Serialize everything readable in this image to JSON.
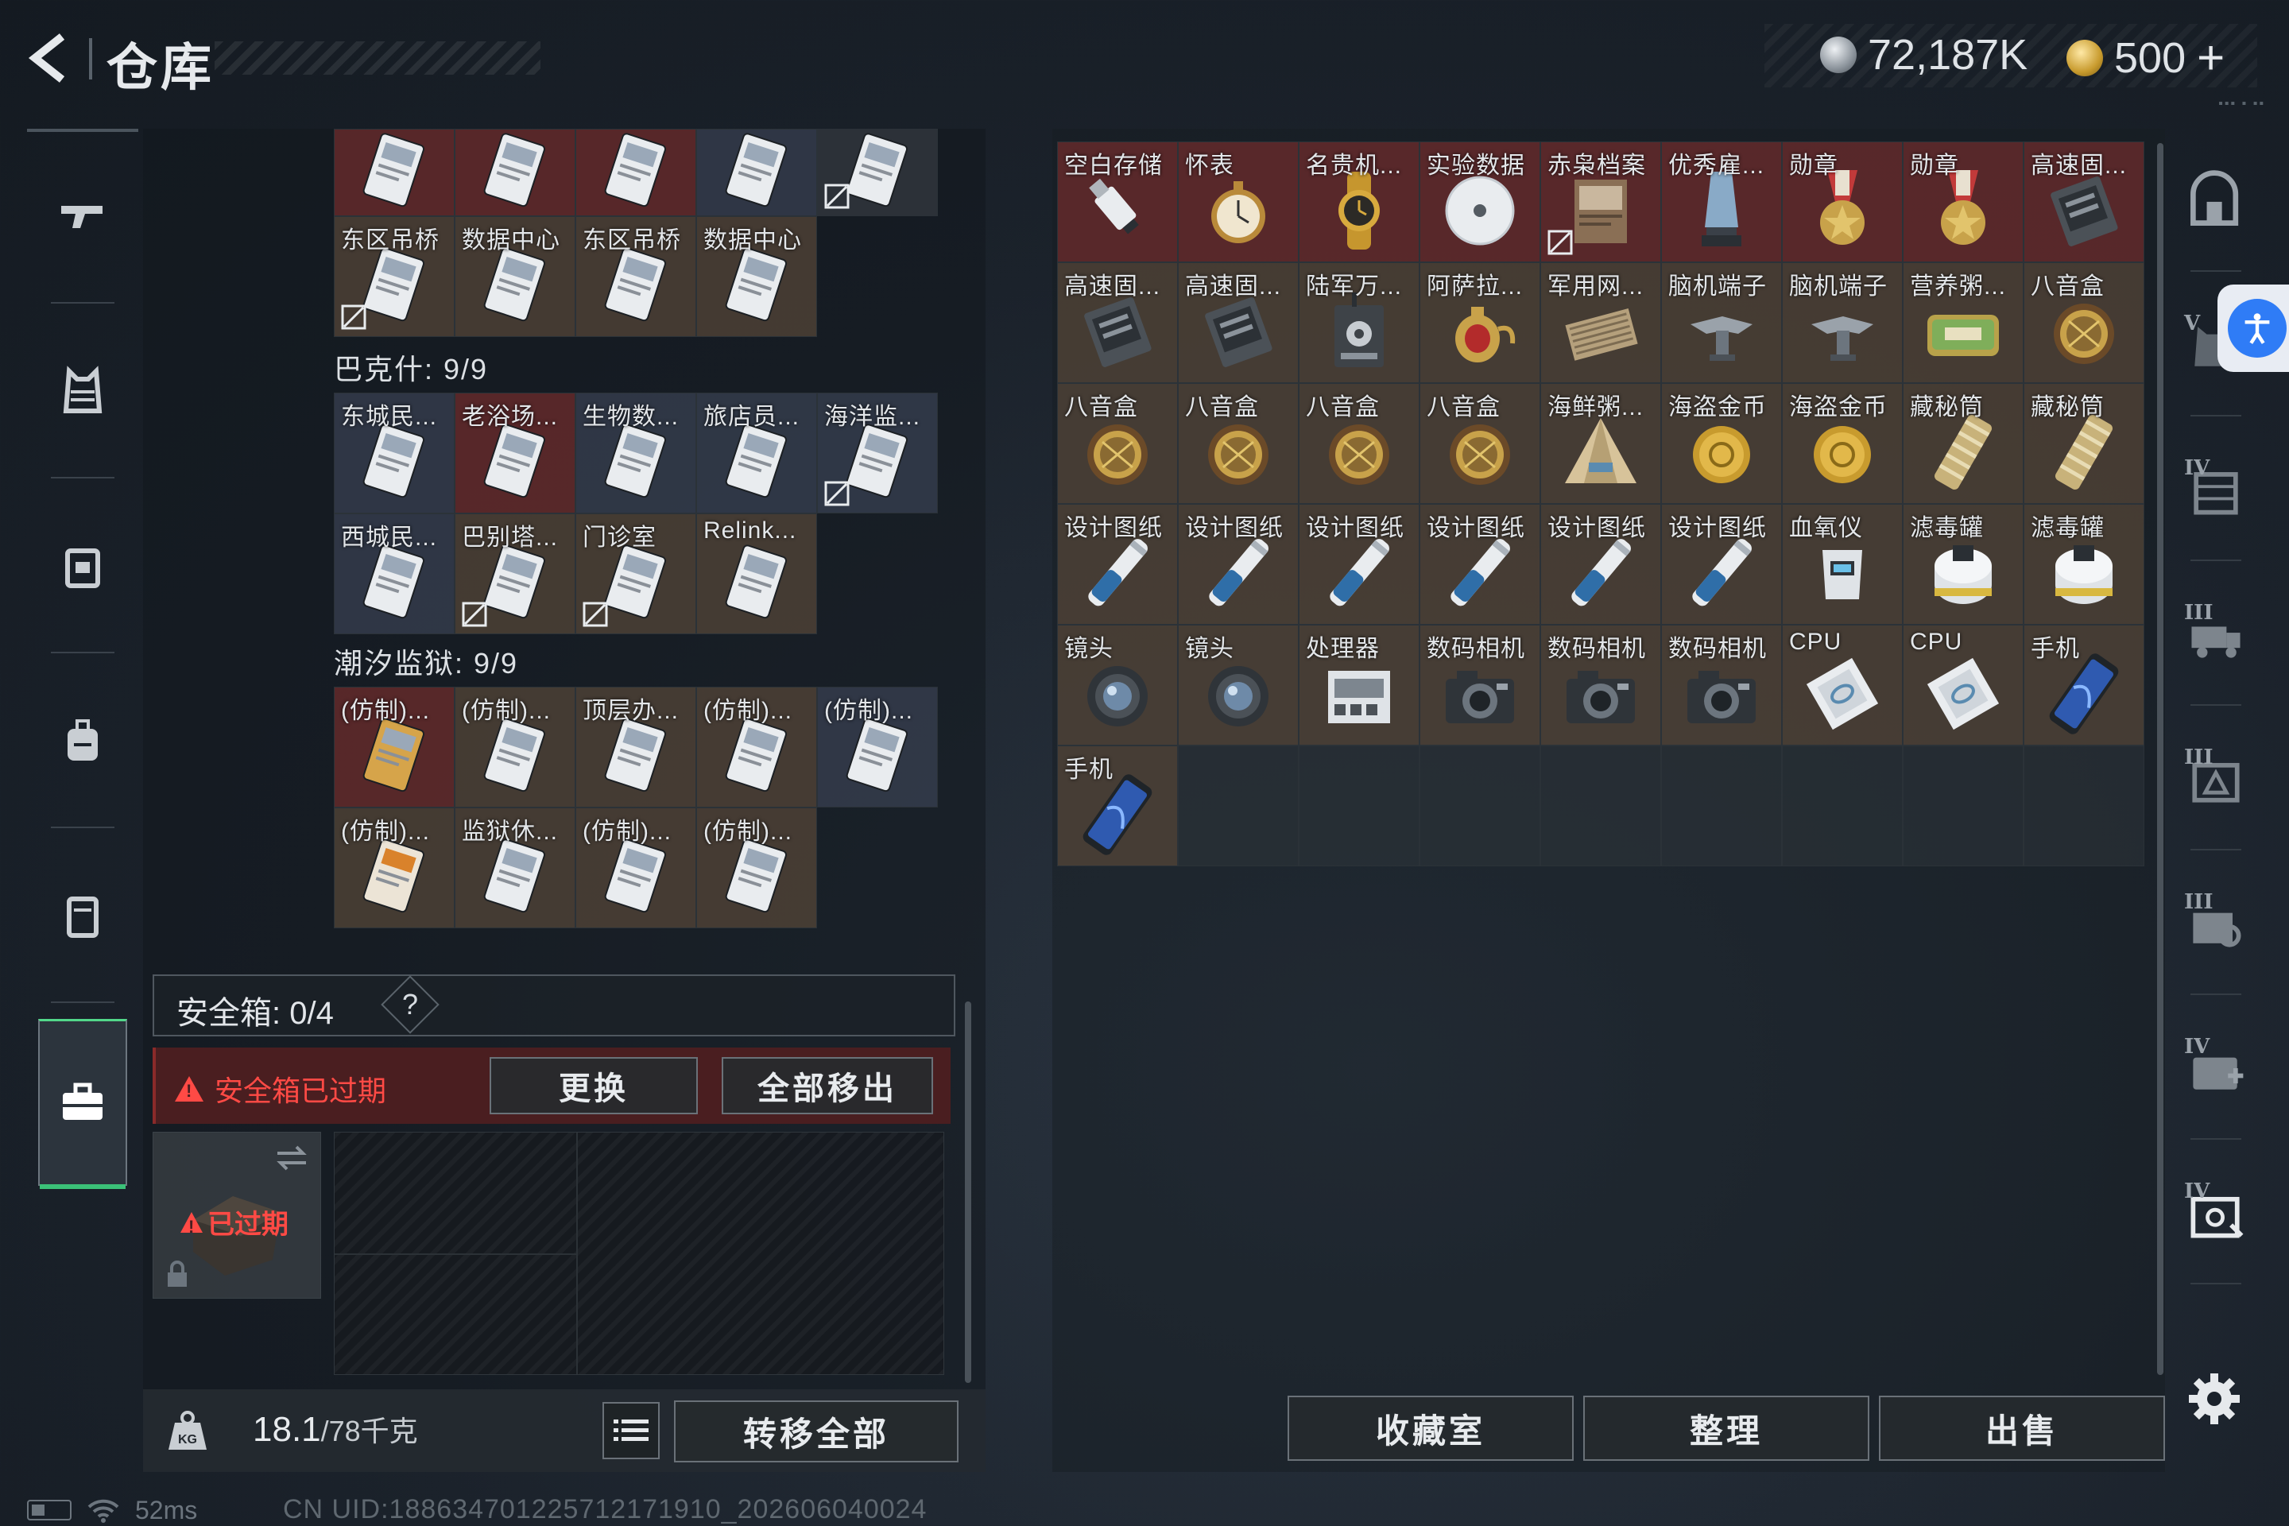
{
  "header": {
    "title": "仓库",
    "currency_silver": "72,187K",
    "currency_gold": "500",
    "plus_label": "+"
  },
  "left_nav": [
    {
      "name": "weapon-tab",
      "icon": "gun-icon"
    },
    {
      "name": "armor-tab",
      "icon": "vest-icon"
    },
    {
      "name": "chest-rig-tab",
      "icon": "rig-icon"
    },
    {
      "name": "backpack-tab",
      "icon": "backpack-icon"
    },
    {
      "name": "pouch-tab",
      "icon": "pouch-icon"
    },
    {
      "name": "safe-box-tab",
      "icon": "briefcase-icon",
      "active": true
    }
  ],
  "backpack": {
    "top_rows": [
      [
        {
          "label": "",
          "bg": "red"
        },
        {
          "label": "",
          "bg": "red"
        },
        {
          "label": "",
          "bg": "red"
        },
        {
          "label": "",
          "bg": "blue"
        },
        {
          "label": "",
          "bg": "dark",
          "mark": true
        }
      ],
      [
        {
          "label": "东区吊桥",
          "bg": "brown",
          "mark": true
        },
        {
          "label": "数据中心",
          "bg": "brown"
        },
        {
          "label": "东区吊桥",
          "bg": "brown"
        },
        {
          "label": "数据中心",
          "bg": "brown"
        }
      ]
    ],
    "group1_label": "巴克什: 9/9",
    "group1": [
      [
        {
          "label": "东城民...",
          "bg": "blue"
        },
        {
          "label": "老浴场...",
          "bg": "red"
        },
        {
          "label": "生物数...",
          "bg": "blue"
        },
        {
          "label": "旅店员...",
          "bg": "blue"
        },
        {
          "label": "海洋监...",
          "bg": "blue",
          "mark": true
        }
      ],
      [
        {
          "label": "西城民...",
          "bg": "blue"
        },
        {
          "label": "巴别塔...",
          "bg": "brown",
          "mark": true
        },
        {
          "label": "门诊室",
          "bg": "brown",
          "mark": true
        },
        {
          "label": "Relink...",
          "bg": "brown"
        }
      ]
    ],
    "group2_label": "潮汐监狱: 9/9",
    "group2": [
      [
        {
          "label": "(仿制)...",
          "bg": "red",
          "gold": true
        },
        {
          "label": "(仿制)...",
          "bg": "brown"
        },
        {
          "label": "顶层办...",
          "bg": "brown"
        },
        {
          "label": "(仿制)...",
          "bg": "brown"
        },
        {
          "label": "(仿制)...",
          "bg": "blue"
        }
      ],
      [
        {
          "label": "(仿制)...",
          "bg": "brown",
          "orange": true
        },
        {
          "label": "监狱休...",
          "bg": "brown"
        },
        {
          "label": "(仿制)...",
          "bg": "brown"
        },
        {
          "label": "(仿制)...",
          "bg": "brown"
        }
      ]
    ]
  },
  "safe_box": {
    "header": "安全箱: 0/4",
    "help": "?",
    "expired_warning": "安全箱已过期",
    "replace_label": "更换",
    "remove_all_label": "全部移出",
    "item_expired_label": "已过期"
  },
  "bottom_left": {
    "weight_value": "18.1",
    "weight_unit": "/78千克",
    "transfer_all_label": "转移全部"
  },
  "stash": {
    "items": [
      {
        "label": "空白存储",
        "icon": "usb",
        "bg": "red"
      },
      {
        "label": "怀表",
        "icon": "watch",
        "bg": "red"
      },
      {
        "label": "名贵机...",
        "icon": "wristwatch",
        "bg": "red"
      },
      {
        "label": "实验数据",
        "icon": "disc",
        "bg": "red"
      },
      {
        "label": "赤枭档案",
        "icon": "file",
        "bg": "red",
        "mark": true
      },
      {
        "label": "优秀雇...",
        "icon": "trophy",
        "bg": "red"
      },
      {
        "label": "勋章",
        "icon": "medal",
        "bg": "red"
      },
      {
        "label": "勋章",
        "icon": "medal",
        "bg": "red"
      },
      {
        "label": "高速固...",
        "icon": "ssd",
        "bg": "red"
      },
      {
        "label": "高速固...",
        "icon": "ssd",
        "bg": "brown"
      },
      {
        "label": "高速固...",
        "icon": "ssd",
        "bg": "brown"
      },
      {
        "label": "陆军万...",
        "icon": "radio",
        "bg": "brown"
      },
      {
        "label": "阿萨拉...",
        "icon": "teapot",
        "bg": "brown"
      },
      {
        "label": "军用网...",
        "icon": "router",
        "bg": "brown"
      },
      {
        "label": "脑机端子",
        "icon": "drone",
        "bg": "brown"
      },
      {
        "label": "脑机端子",
        "icon": "drone",
        "bg": "brown"
      },
      {
        "label": "营养粥...",
        "icon": "tin",
        "bg": "brown"
      },
      {
        "label": "八音盒",
        "icon": "musicbox",
        "bg": "brown"
      },
      {
        "label": "八音盒",
        "icon": "musicbox",
        "bg": "brown"
      },
      {
        "label": "八音盒",
        "icon": "musicbox",
        "bg": "brown"
      },
      {
        "label": "八音盒",
        "icon": "musicbox",
        "bg": "brown"
      },
      {
        "label": "八音盒",
        "icon": "musicbox",
        "bg": "brown"
      },
      {
        "label": "海鲜粥...",
        "icon": "pyramid",
        "bg": "brown"
      },
      {
        "label": "海盗金币",
        "icon": "coin",
        "bg": "brown"
      },
      {
        "label": "海盗金币",
        "icon": "coin",
        "bg": "brown"
      },
      {
        "label": "藏秘筒",
        "icon": "scroll",
        "bg": "brown"
      },
      {
        "label": "藏秘筒",
        "icon": "scroll",
        "bg": "brown"
      },
      {
        "label": "设计图纸",
        "icon": "blueprint",
        "bg": "brown"
      },
      {
        "label": "设计图纸",
        "icon": "blueprint",
        "bg": "brown"
      },
      {
        "label": "设计图纸",
        "icon": "blueprint",
        "bg": "brown"
      },
      {
        "label": "设计图纸",
        "icon": "blueprint",
        "bg": "brown"
      },
      {
        "label": "设计图纸",
        "icon": "blueprint",
        "bg": "brown"
      },
      {
        "label": "设计图纸",
        "icon": "blueprint",
        "bg": "brown"
      },
      {
        "label": "血氧仪",
        "icon": "oximeter",
        "bg": "brown"
      },
      {
        "label": "滤毒罐",
        "icon": "filter",
        "bg": "brown"
      },
      {
        "label": "滤毒罐",
        "icon": "filter",
        "bg": "brown"
      },
      {
        "label": "镜头",
        "icon": "lens",
        "bg": "brown"
      },
      {
        "label": "镜头",
        "icon": "lens",
        "bg": "brown"
      },
      {
        "label": "处理器",
        "icon": "processor",
        "bg": "brown"
      },
      {
        "label": "数码相机",
        "icon": "camera",
        "bg": "brown"
      },
      {
        "label": "数码相机",
        "icon": "camera",
        "bg": "brown"
      },
      {
        "label": "数码相机",
        "icon": "camera",
        "bg": "brown"
      },
      {
        "label": "CPU",
        "icon": "cpu",
        "bg": "brown"
      },
      {
        "label": "CPU",
        "icon": "cpu",
        "bg": "brown"
      },
      {
        "label": "手机",
        "icon": "phone",
        "bg": "brown"
      },
      {
        "label": "手机",
        "icon": "phone",
        "bg": "brown"
      }
    ],
    "empty_slots": 8,
    "collection_label": "收藏室",
    "sort_label": "整理",
    "sell_label": "出售"
  },
  "right_rail": [
    {
      "name": "stash-home",
      "icon": "arch-icon",
      "tier": ""
    },
    {
      "name": "stash-tier-v",
      "icon": "vest-icon",
      "tier": "V"
    },
    {
      "name": "stash-tier-iv-a",
      "icon": "cabinet-icon",
      "tier": "IV"
    },
    {
      "name": "stash-tier-iii-a",
      "icon": "truck-icon",
      "tier": "III"
    },
    {
      "name": "stash-tier-iii-b",
      "icon": "crate-icon",
      "tier": "III"
    },
    {
      "name": "stash-tier-iii-c",
      "icon": "gear-crate-icon",
      "tier": "III"
    },
    {
      "name": "stash-tier-iv-b",
      "icon": "medkit-icon",
      "tier": "IV"
    },
    {
      "name": "stash-tier-iv-c",
      "icon": "safe-icon",
      "tier": "IV"
    }
  ],
  "status": {
    "ping": "52ms",
    "uid": "CN UID:1886347012257121719​10_202606040024"
  },
  "colors": {
    "accent_green": "#3bc178",
    "warning_red": "#ff4a45",
    "access_blue": "#2f7cf6"
  }
}
